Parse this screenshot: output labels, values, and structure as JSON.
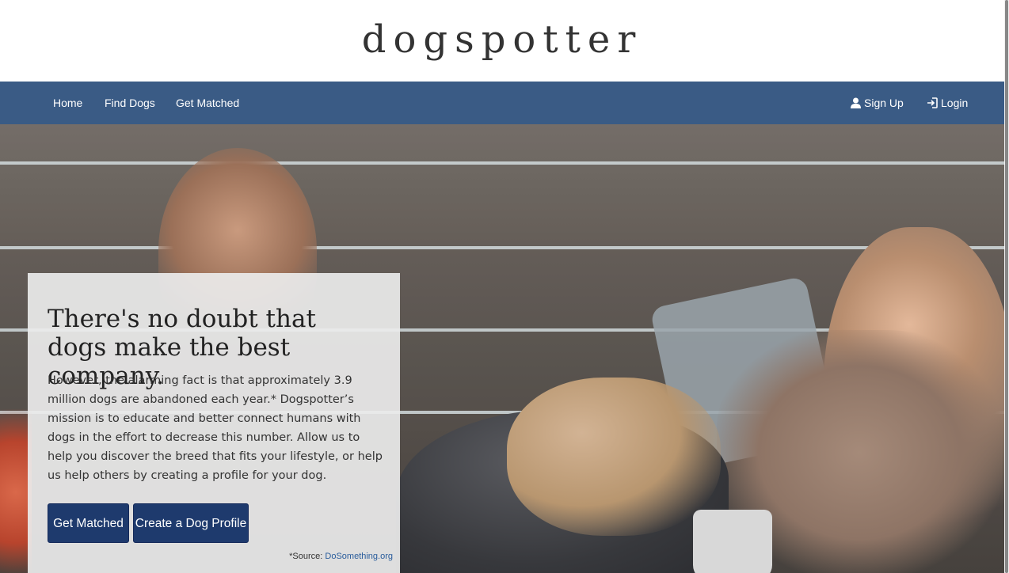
{
  "brand": {
    "name": "dogspotter"
  },
  "nav": {
    "home": "Home",
    "find_dogs": "Find Dogs",
    "get_matched": "Get Matched",
    "sign_up": "Sign Up",
    "login": "Login"
  },
  "hero": {
    "title": "There's no doubt that dogs make the best company.",
    "body": "However, the alarming fact is that approximately 3.9 million dogs are abandoned each year.* Dogspotter’s mission is to educate and better connect humans with dogs in the effort to decrease this number. Allow us to help you discover the breed that fits your lifestyle, or help us help others by creating a profile for your dog.",
    "buttons": {
      "get_matched": "Get Matched",
      "create_profile": "Create a Dog Profile"
    },
    "source_prefix": "*Source:",
    "source_link": "DoSomething.org"
  },
  "icons": {
    "user": "user-icon",
    "login": "login-icon"
  },
  "colors": {
    "navbar": "#3a5b85",
    "button": "#1e3a6d",
    "link": "#2a5d9c"
  }
}
